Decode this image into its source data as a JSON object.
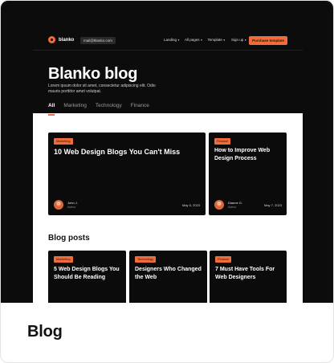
{
  "preview": {
    "nav": {
      "logo_text": "blanko",
      "email": "mail@blanko.com",
      "links": [
        "Landing",
        "All pages",
        "Template"
      ],
      "signup": "Sign up",
      "buy_button": "Purchase template"
    },
    "hero": {
      "title": "Blanko blog",
      "description": "Lorem ipsum dolor sit amet, consectetur adipiscing elit. Odio mauris porttitor amet volutpat."
    },
    "tabs": [
      "All",
      "Marketing",
      "Technology",
      "Finance"
    ],
    "featured": [
      {
        "badge": "Marketing",
        "title": "10 Web Design Blogs You Can't Miss",
        "author": "John J.",
        "role": "Author",
        "date": "May 5, 2023"
      },
      {
        "badge": "Finance",
        "title": "How to Improve Web Design Process",
        "author": "Dianne G.",
        "role": "Author",
        "date": "May 7, 2023"
      }
    ],
    "section_title": "Blog posts",
    "posts": [
      {
        "badge": "Marketing",
        "title": "5 Web Design Blogs You Should Be Reading"
      },
      {
        "badge": "Technology",
        "title": "Designers Who Changed the Web"
      },
      {
        "badge": "Finance",
        "title": "7 Must Have Tools For Web Designers"
      }
    ]
  },
  "caption": "Blog",
  "colors": {
    "accent": "#f26b3a",
    "dark": "#0c0c0c",
    "text": "#111111"
  }
}
